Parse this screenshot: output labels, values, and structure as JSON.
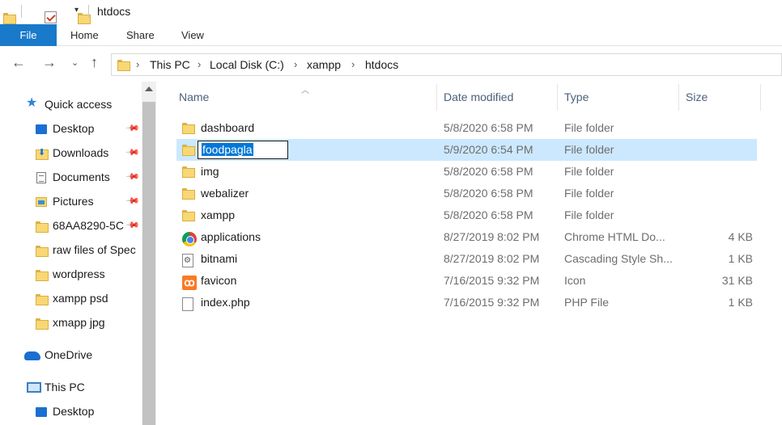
{
  "window": {
    "title": "htdocs"
  },
  "ribbon": {
    "tabs": [
      "File",
      "Home",
      "Share",
      "View"
    ]
  },
  "address": {
    "crumbs": [
      "This PC",
      "Local Disk (C:)",
      "xampp",
      "htdocs"
    ]
  },
  "nav": {
    "items": [
      {
        "label": "Quick access",
        "icon": "star-icon",
        "pinned": false
      },
      {
        "label": "Desktop",
        "icon": "desktop-icon",
        "pinned": true
      },
      {
        "label": "Downloads",
        "icon": "downloads-icon",
        "pinned": true
      },
      {
        "label": "Documents",
        "icon": "documents-icon",
        "pinned": true
      },
      {
        "label": "Pictures",
        "icon": "pictures-icon",
        "pinned": true
      },
      {
        "label": "68AA8290-5C",
        "icon": "folder-icon",
        "pinned": true
      },
      {
        "label": "raw files of Spec",
        "icon": "folder-icon",
        "pinned": false
      },
      {
        "label": "wordpress",
        "icon": "folder-icon",
        "pinned": false
      },
      {
        "label": "xampp psd",
        "icon": "folder-icon",
        "pinned": false
      },
      {
        "label": "xmapp jpg",
        "icon": "folder-icon",
        "pinned": false
      },
      {
        "label": "OneDrive",
        "icon": "onedrive-icon",
        "pinned": false
      },
      {
        "label": "This PC",
        "icon": "this-pc-icon",
        "pinned": false
      },
      {
        "label": "Desktop",
        "icon": "desktop-icon",
        "pinned": false
      }
    ]
  },
  "columns": {
    "name": "Name",
    "date": "Date modified",
    "type": "Type",
    "size": "Size"
  },
  "files": [
    {
      "name": "dashboard",
      "date": "5/8/2020 6:58 PM",
      "type": "File folder",
      "size": "",
      "icon": "folder-icon"
    },
    {
      "name": "foodpagla",
      "date": "5/9/2020 6:54 PM",
      "type": "File folder",
      "size": "",
      "icon": "folder-icon",
      "selected": true,
      "renaming": true
    },
    {
      "name": "img",
      "date": "5/8/2020 6:58 PM",
      "type": "File folder",
      "size": "",
      "icon": "folder-icon"
    },
    {
      "name": "webalizer",
      "date": "5/8/2020 6:58 PM",
      "type": "File folder",
      "size": "",
      "icon": "folder-icon"
    },
    {
      "name": "xampp",
      "date": "5/8/2020 6:58 PM",
      "type": "File folder",
      "size": "",
      "icon": "folder-icon"
    },
    {
      "name": "applications",
      "date": "8/27/2019 8:02 PM",
      "type": "Chrome HTML Do...",
      "size": "4 KB",
      "icon": "chrome-html-icon"
    },
    {
      "name": "bitnami",
      "date": "8/27/2019 8:02 PM",
      "type": "Cascading Style Sh...",
      "size": "1 KB",
      "icon": "css-file-icon"
    },
    {
      "name": "favicon",
      "date": "7/16/2015 9:32 PM",
      "type": "Icon",
      "size": "31 KB",
      "icon": "xampp-icon"
    },
    {
      "name": "index.php",
      "date": "7/16/2015 9:32 PM",
      "type": "PHP File",
      "size": "1 KB",
      "icon": "php-file-icon"
    }
  ],
  "colors": {
    "accent": "#1979ca",
    "selection": "#cce8ff",
    "folder": "#f8d775"
  }
}
